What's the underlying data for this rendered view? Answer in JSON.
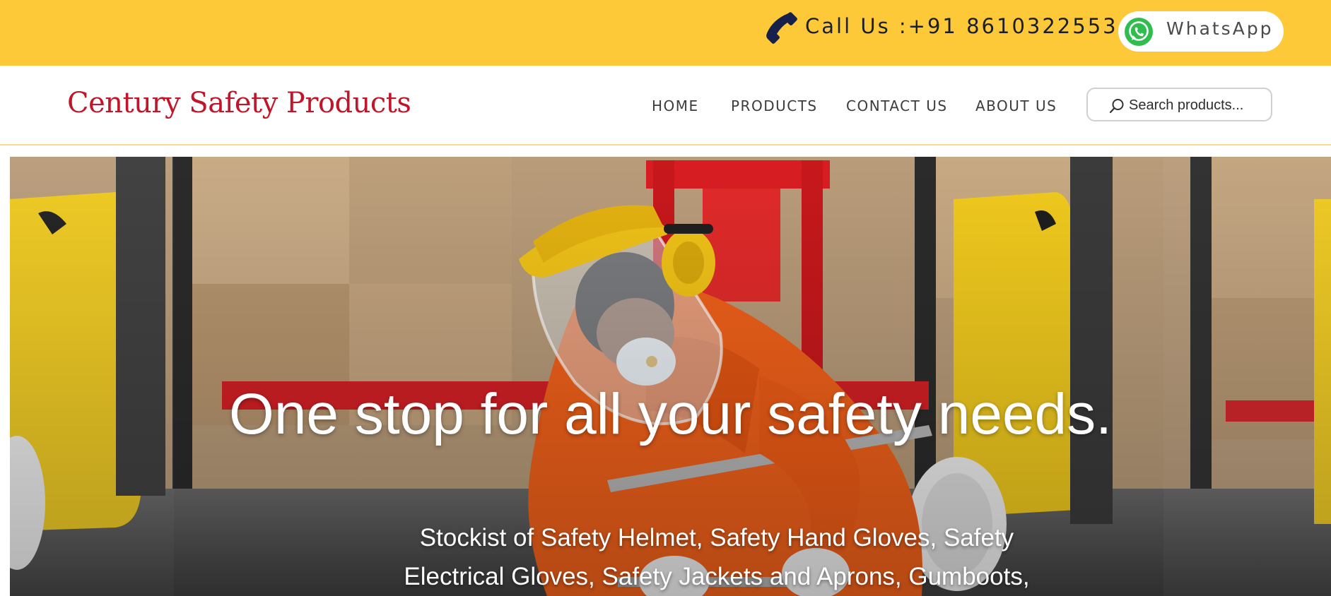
{
  "topbar": {
    "phone_icon": "phone-icon",
    "call_text": "Call Us :+91 8610322553",
    "whatsapp_label": "WhatsApp",
    "whatsapp_icon": "whatsapp-icon",
    "background_color": "#fdc939"
  },
  "header": {
    "logo_text": "Century Safety Products",
    "logo_color": "#c0162a",
    "nav": {
      "home": "HOME",
      "products": "PRODUCTS",
      "contact": "CONTACT US",
      "about": "ABOUT US"
    },
    "search": {
      "placeholder": "Search products...",
      "icon": "search-icon"
    }
  },
  "hero": {
    "title": "One stop for all your safety needs.",
    "subtitle": "Stockist of Safety Helmet, Safety Hand Gloves, Safety Electrical Gloves, Safety Jackets and Aprons, Gumboots,"
  }
}
